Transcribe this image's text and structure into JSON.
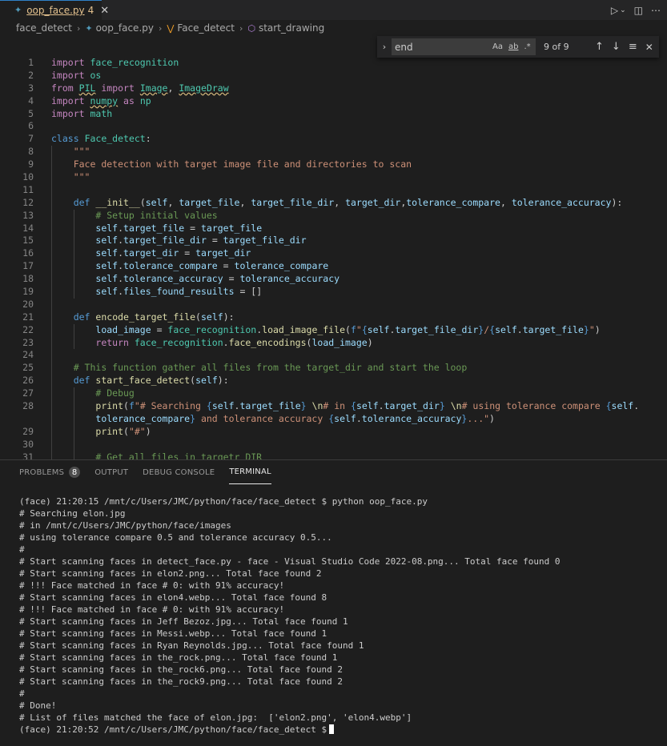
{
  "tab": {
    "filename": "oop_face.py",
    "problem_count": "4"
  },
  "breadcrumb": [
    "face_detect",
    "oop_face.py",
    "Face_detect",
    "start_drawing"
  ],
  "find": {
    "query": "end",
    "case_label": "Aa",
    "word_label": "ab",
    "regex_label": ".*",
    "count": "9 of 9"
  },
  "code": [
    {
      "n": "1",
      "i": 0,
      "h": "<span class='kc'>import</span> <span class='cls'>face_recognition</span>"
    },
    {
      "n": "2",
      "i": 0,
      "h": "<span class='kc'>import</span> <span class='cls'>os</span>"
    },
    {
      "n": "3",
      "i": 0,
      "h": "<span class='kc'>from</span> <span class='cls sq'>PIL</span> <span class='kc'>import</span> <span class='cls sq'>Image</span>, <span class='cls sq'>ImageDraw</span>"
    },
    {
      "n": "4",
      "i": 0,
      "h": "<span class='kc'>import</span> <span class='cls sq'>numpy</span> <span class='kc'>as</span> <span class='cls'>np</span>"
    },
    {
      "n": "5",
      "i": 0,
      "h": "<span class='kc'>import</span> <span class='cls'>math</span>"
    },
    {
      "n": "6",
      "i": 0,
      "h": ""
    },
    {
      "n": "7",
      "i": 0,
      "h": "<span class='kw'>class</span> <span class='cls'>Face_detect</span>:"
    },
    {
      "n": "8",
      "i": 1,
      "h": "    <span class='str'>\"\"\"</span>"
    },
    {
      "n": "9",
      "i": 1,
      "h": "    <span class='str'>Face detection with target image file and directories to scan</span>"
    },
    {
      "n": "10",
      "i": 1,
      "h": "    <span class='str'>\"\"\"</span>"
    },
    {
      "n": "11",
      "i": 1,
      "h": ""
    },
    {
      "n": "12",
      "i": 1,
      "h": "    <span class='kw'>def</span> <span class='fn'>__init__</span>(<span class='v'>self</span>, <span class='v'>target_file</span>, <span class='v'>target_file_dir</span>, <span class='v'>target_dir</span>,<span class='v'>tolerance_compare</span>, <span class='v'>tolerance_accuracy</span>):"
    },
    {
      "n": "13",
      "i": 2,
      "h": "        <span class='cm'># Setup initial values</span>"
    },
    {
      "n": "14",
      "i": 2,
      "h": "        <span class='v'>self</span>.<span class='v'>target_file</span> = <span class='v'>target_file</span>"
    },
    {
      "n": "15",
      "i": 2,
      "h": "        <span class='v'>self</span>.<span class='v'>target_file_dir</span> = <span class='v'>target_file_dir</span>"
    },
    {
      "n": "16",
      "i": 2,
      "h": "        <span class='v'>self</span>.<span class='v'>target_dir</span> = <span class='v'>target_dir</span>"
    },
    {
      "n": "17",
      "i": 2,
      "h": "        <span class='v'>self</span>.<span class='v'>tolerance_compare</span> = <span class='v'>tolerance_compare</span>"
    },
    {
      "n": "18",
      "i": 2,
      "h": "        <span class='v'>self</span>.<span class='v'>tolerance_accuracy</span> = <span class='v'>tolerance_accuracy</span>"
    },
    {
      "n": "19",
      "i": 2,
      "h": "        <span class='v'>self</span>.<span class='v'>files_found_resuilts</span> = []"
    },
    {
      "n": "20",
      "i": 1,
      "h": ""
    },
    {
      "n": "21",
      "i": 1,
      "h": "    <span class='kw'>def</span> <span class='fn'>encode_target_file</span>(<span class='v'>self</span>):"
    },
    {
      "n": "22",
      "i": 2,
      "h": "        <span class='v'>load_image</span> = <span class='cls'>face_recognition</span>.<span class='fn'>load_image_file</span>(<span class='kw'>f</span><span class='str'>\"</span><span class='kw'>{</span><span class='v'>self</span>.<span class='v'>target_file_dir</span><span class='kw'>}</span><span class='str'>/</span><span class='kw'>{</span><span class='v'>self</span>.<span class='v'>target_file</span><span class='kw'>}</span><span class='str'>\"</span>)"
    },
    {
      "n": "23",
      "i": 2,
      "h": "        <span class='kc'>return</span> <span class='cls'>face_recognition</span>.<span class='fn'>face_encodings</span>(<span class='v'>load_image</span>)"
    },
    {
      "n": "24",
      "i": 1,
      "h": ""
    },
    {
      "n": "25",
      "i": 1,
      "h": "    <span class='cm'># This function gather all files from the target_dir and start the loop</span>"
    },
    {
      "n": "26",
      "i": 1,
      "h": "    <span class='kw'>def</span> <span class='fn'>start_face_detect</span>(<span class='v'>self</span>):"
    },
    {
      "n": "27",
      "i": 2,
      "h": "        <span class='cm'># Debug</span>"
    },
    {
      "n": "28",
      "i": 2,
      "h": "        <span class='fn'>print</span>(<span class='kw'>f</span><span class='str'>\"# Searching </span><span class='kw'>{</span><span class='v'>self</span>.<span class='v'>target_file</span><span class='kw'>}</span><span class='str'> </span><span class='fn'>\\n</span><span class='str'># in </span><span class='kw'>{</span><span class='v'>self</span>.<span class='v'>target_dir</span><span class='kw'>}</span><span class='str'> </span><span class='fn'>\\n</span><span class='str'># using tolerance compare </span><span class='kw'>{</span><span class='v'>self</span>."
    },
    {
      "n": "",
      "i": 2,
      "h": "        <span class='v'>tolerance_compare</span><span class='kw'>}</span><span class='str'> and tolerance accuracy </span><span class='kw'>{</span><span class='v'>self</span>.<span class='v'>tolerance_accuracy</span><span class='kw'>}</span><span class='str'>...\"</span>)"
    },
    {
      "n": "29",
      "i": 2,
      "h": "        <span class='fn'>print</span>(<span class='str'>\"#\"</span>)"
    },
    {
      "n": "30",
      "i": 2,
      "h": ""
    },
    {
      "n": "31",
      "i": 2,
      "h": "        <span class='cm'># Get all files in targetr DIR</span>"
    }
  ],
  "panel": {
    "tabs": [
      "PROBLEMS",
      "OUTPUT",
      "DEBUG CONSOLE",
      "TERMINAL"
    ],
    "problems_badge": "8",
    "terminal_lines": [
      "(face) 21:20:15 /mnt/c/Users/JMC/python/face/face_detect $ python oop_face.py",
      "# Searching elon.jpg",
      "# in /mnt/c/Users/JMC/python/face/images",
      "# using tolerance compare 0.5 and tolerance accuracy 0.5...",
      "#",
      "# Start scanning faces in detect_face.py - face - Visual Studio Code 2022-08.png... Total face found 0",
      "# Start scanning faces in elon2.png... Total face found 2",
      "# !!! Face matched in face # 0: with 91% accuracy!",
      "# Start scanning faces in elon4.webp... Total face found 8",
      "# !!! Face matched in face # 0: with 91% accuracy!",
      "# Start scanning faces in Jeff Bezoz.jpg... Total face found 1",
      "# Start scanning faces in Messi.webp... Total face found 1",
      "# Start scanning faces in Ryan Reynolds.jpg... Total face found 1",
      "# Start scanning faces in the_rock.png... Total face found 1",
      "# Start scanning faces in the_rock6.png... Total face found 2",
      "# Start scanning faces in the_rock9.png... Total face found 2",
      "#",
      "# Done!",
      "# List of files matched the face of elon.jpg:  ['elon2.png', 'elon4.webp']",
      "(face) 21:20:52 /mnt/c/Users/JMC/python/face/face_detect $"
    ]
  }
}
